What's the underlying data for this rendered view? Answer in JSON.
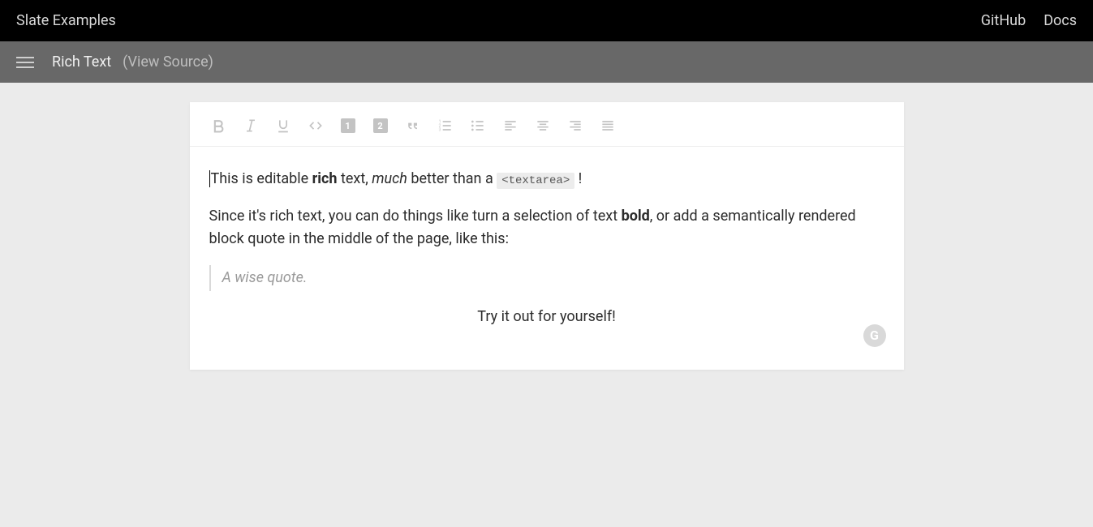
{
  "topbar": {
    "brand": "Slate Examples",
    "links": {
      "github": "GitHub",
      "docs": "Docs"
    }
  },
  "subbar": {
    "title": "Rich Text",
    "view_source": "(View Source)"
  },
  "toolbar": {
    "icons": {
      "bold": "bold-icon",
      "italic": "italic-icon",
      "underline": "underline-icon",
      "code": "code-icon",
      "h1": "heading-one-icon",
      "h2": "heading-two-icon",
      "quote": "blockquote-icon",
      "ol": "numbered-list-icon",
      "ul": "bulleted-list-icon",
      "align_left": "align-left-icon",
      "align_center": "align-center-icon",
      "align_right": "align-right-icon",
      "align_justify": "align-justify-icon"
    },
    "h1_label": "1",
    "h2_label": "2"
  },
  "content": {
    "p1": {
      "t1": "This is editable ",
      "bold": "rich",
      "t2": " text, ",
      "italic": "much",
      "t3": " better than a ",
      "code": "<textarea>",
      "t4": " !"
    },
    "p2": {
      "t1": "Since it's rich text, you can do things like turn a selection of text ",
      "bold": "bold",
      "t2": ", or add a semantically rendered block quote in the middle of the page, like this:"
    },
    "quote": "A wise quote.",
    "p3": "Try it out for yourself!"
  },
  "badge": {
    "letter": "G"
  }
}
